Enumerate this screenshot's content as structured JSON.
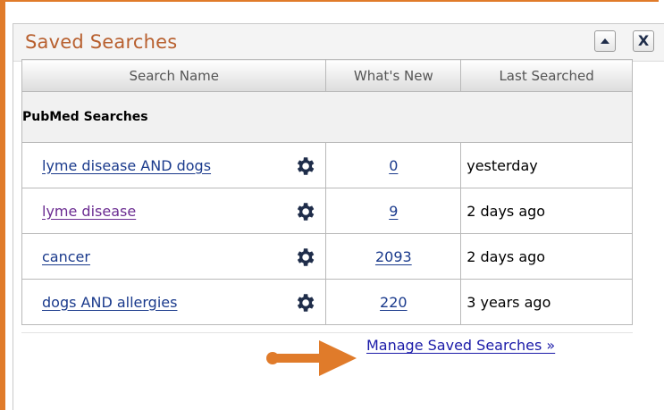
{
  "panel": {
    "title": "Saved Searches",
    "close_label": "X"
  },
  "table": {
    "headers": [
      "Search Name",
      "What's New",
      "Last Searched"
    ],
    "group_label": "PubMed Searches",
    "rows": [
      {
        "name": "lyme disease AND dogs",
        "new": "0",
        "last": "yesterday",
        "visited": false
      },
      {
        "name": "lyme disease",
        "new": "9",
        "last": "2 days ago",
        "visited": true
      },
      {
        "name": "cancer",
        "new": "2093",
        "last": "2 days ago",
        "visited": false
      },
      {
        "name": "dogs AND allergies",
        "new": "220",
        "last": "3 years ago",
        "visited": false
      }
    ]
  },
  "footer": {
    "manage_link": "Manage Saved Searches »"
  },
  "colors": {
    "accent_orange": "#e07b2a",
    "title_color": "#b8602f",
    "link_blue": "#1a3a8c",
    "link_visited": "#6b2c91"
  },
  "icons": [
    "collapse-icon",
    "close-icon",
    "gear-icon",
    "arrow-right-icon"
  ]
}
